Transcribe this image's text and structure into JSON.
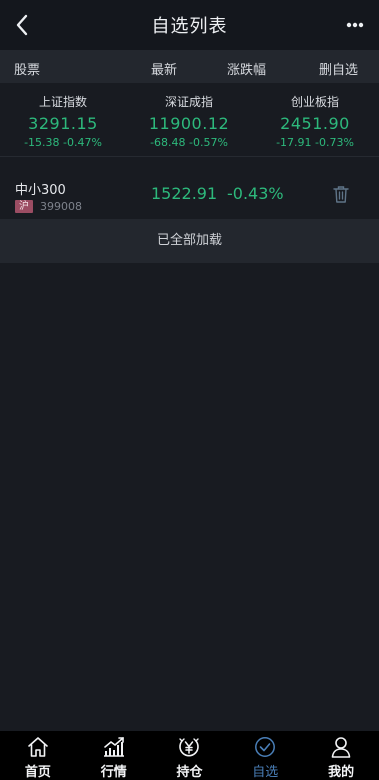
{
  "header": {
    "title": "自选列表"
  },
  "columns": {
    "stock": "股票",
    "latest": "最新",
    "change": "涨跌幅",
    "delete": "删自选"
  },
  "indices": [
    {
      "name": "上证指数",
      "price": "3291.15",
      "change": "-15.38 -0.47%"
    },
    {
      "name": "深证成指",
      "price": "11900.12",
      "change": "-68.48 -0.57%"
    },
    {
      "name": "创业板指",
      "price": "2451.90",
      "change": "-17.91 -0.73%"
    }
  ],
  "watchlist": [
    {
      "name": "中小300",
      "market": "沪",
      "code": "399008",
      "price": "1522.91",
      "pct": "-0.43%"
    }
  ],
  "list_footer": "已全部加载",
  "tabs": [
    {
      "label": "首页",
      "icon": "home-icon"
    },
    {
      "label": "行情",
      "icon": "chart-icon"
    },
    {
      "label": "持仓",
      "icon": "yuan-icon"
    },
    {
      "label": "自选",
      "icon": "check-circle-icon"
    },
    {
      "label": "我的",
      "icon": "user-icon"
    }
  ],
  "colors": {
    "up_down_green": "#2db97c",
    "active_tab": "#4a7fb8",
    "market_badge": "#9b4d63"
  }
}
